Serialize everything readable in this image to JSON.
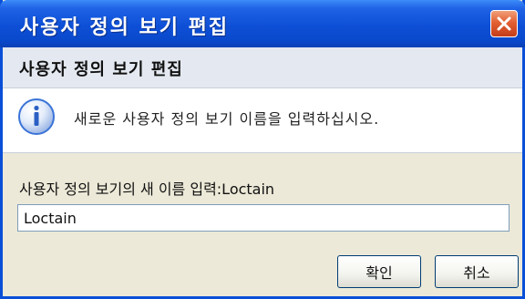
{
  "window": {
    "title": "사용자 정의 보기 편집"
  },
  "header": {
    "title": "사용자 정의 보기 편집"
  },
  "info": {
    "icon": "info-icon",
    "message": "새로운 사용자 정의 보기 이름을 입력하십시오."
  },
  "form": {
    "prompt_label": "사용자 정의 보기의 새 이름 입력:Loctain",
    "name_value": "Loctain"
  },
  "buttons": {
    "ok_label": "확인",
    "cancel_label": "취소"
  },
  "colors": {
    "titlebar": "#0d4fd6",
    "close_button": "#e35f33",
    "header_band": "#e4e9f1",
    "dialog_face": "#ece9d8",
    "info_icon": "#3b74d8"
  }
}
